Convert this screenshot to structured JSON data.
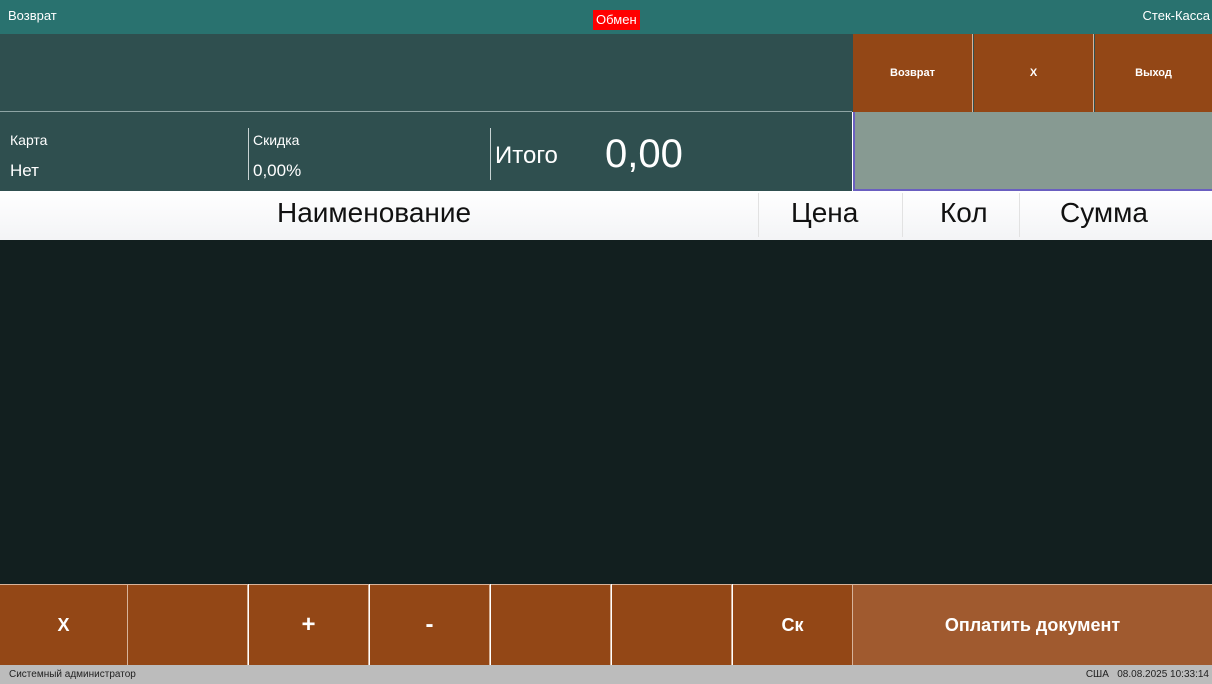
{
  "titlebar": {
    "left": "Возврат",
    "middle": "Обмен",
    "right": "Стек-Касса"
  },
  "top_buttons": {
    "return": "Возврат",
    "x": "X",
    "exit": "Выход"
  },
  "info": {
    "card_label": "Карта",
    "card_value": "Нет",
    "discount_label": "Скидка",
    "discount_value": "0,00%",
    "total_label": "Итого",
    "total_value": "0,00"
  },
  "grid": {
    "columns": [
      "Наименование",
      "Цена",
      "Кол",
      "Сумма"
    ],
    "rows": []
  },
  "bottom_buttons": {
    "b1": "X",
    "b2": "",
    "b3": "+",
    "b4": "-",
    "b5": "",
    "b6": "",
    "b7": "Ск",
    "pay": "Оплатить документ"
  },
  "status": {
    "user": "Системный администратор",
    "locale": "США",
    "datetime": "08.08.2025 10:33:14"
  }
}
